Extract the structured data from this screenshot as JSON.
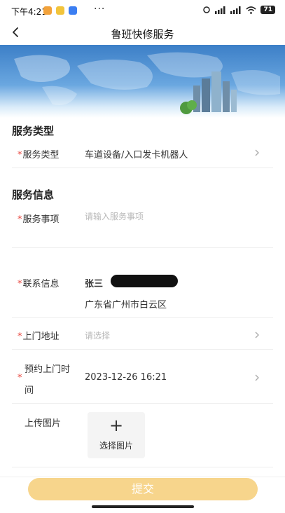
{
  "status_bar": {
    "time": "下午4:21",
    "battery": "71"
  },
  "nav": {
    "title": "鲁班快修服务"
  },
  "sections": {
    "service_type_title": "服务类型",
    "service_info_title": "服务信息"
  },
  "form": {
    "service_type": {
      "required": "*",
      "label": "服务类型",
      "value": "车道设备/入口发卡机器人"
    },
    "service_item": {
      "required": "*",
      "label": "服务事项",
      "placeholder": "请输入服务事项"
    },
    "contact": {
      "required": "*",
      "label": "联系信息",
      "name": "张三",
      "address": "广东省广州市白云区"
    },
    "visit_address": {
      "required": "*",
      "label": "上门地址",
      "placeholder": "请选择"
    },
    "appointment": {
      "required": "*",
      "label_line1": "预约上门时",
      "label_line2": "间",
      "value": "2023-12-26 16:21"
    },
    "upload": {
      "label": "上传图片",
      "button_icon": "+",
      "button_label": "选择图片"
    }
  },
  "submit": {
    "label": "提交"
  },
  "colors": {
    "accent_required": "#e8433b",
    "submit_bg": "#f7d58c",
    "banner_blue": "#3c7fc7"
  },
  "icons": [
    "back-arrow-icon",
    "chevron-right-icon",
    "plus-icon",
    "wifi-icon",
    "signal-icon",
    "battery-icon"
  ]
}
